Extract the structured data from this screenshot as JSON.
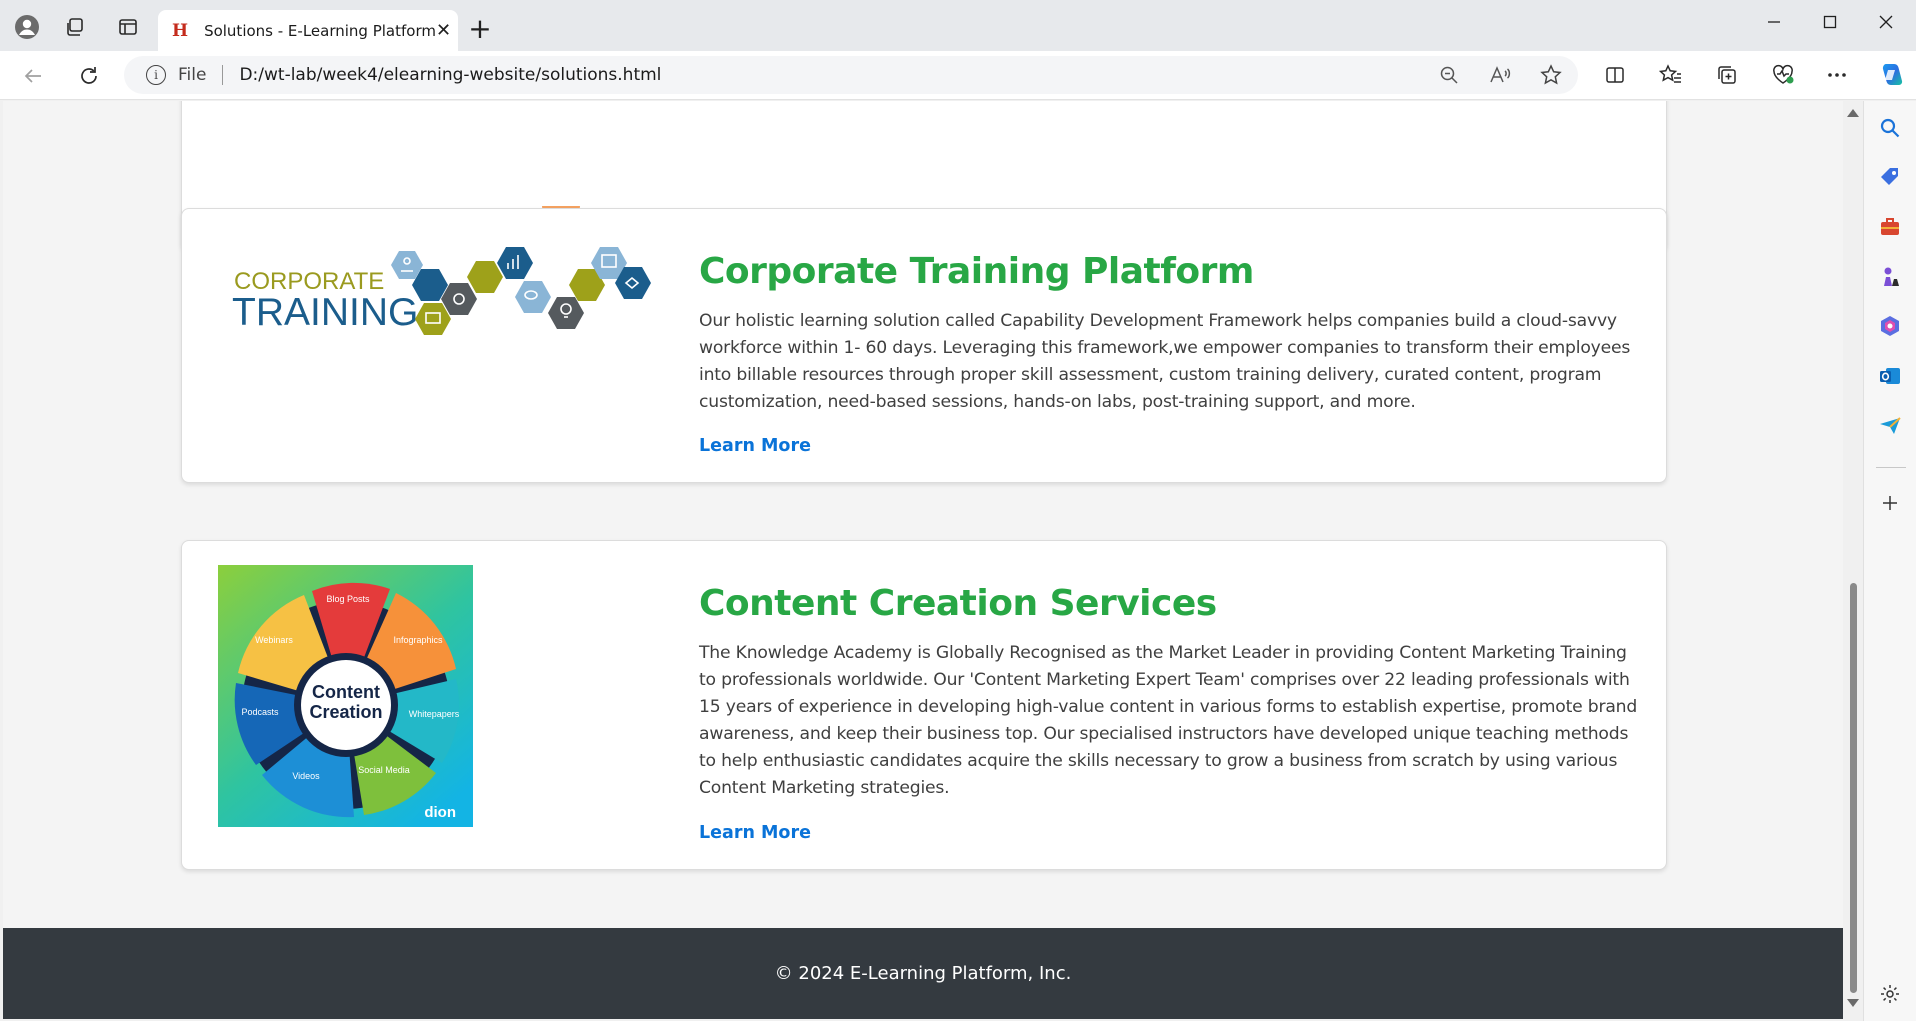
{
  "browser": {
    "tab_title": "Solutions - E-Learning Platform",
    "tab_favicon_letter": "H",
    "tab_close": "✕",
    "new_tab": "+",
    "url_scheme": "File",
    "url": "D:/wt-lab/week4/elearning-website/solutions.html"
  },
  "cards": [
    {
      "image_caption_line1": "CORPORATE",
      "image_caption_line2": "TRAINING",
      "title": "Corporate Training Platform",
      "description": "Our holistic learning solution called Capability Development Framework helps companies build a cloud-savvy workforce within 1- 60 days. Leveraging this framework,we empower companies to transform their employees into billable resources through proper skill assessment, custom training delivery, curated content, program customization, need-based sessions, hands-on labs, post-training support, and more.",
      "link": "Learn More"
    },
    {
      "image_center_line1": "Content",
      "image_center_line2": "Creation",
      "image_segments": [
        "Blog Posts",
        "Infographics",
        "Whitepapers",
        "Social Media",
        "Videos",
        "Podcasts",
        "Webinars"
      ],
      "image_brand": "dion",
      "title": "Content Creation Services",
      "description": "The Knowledge Academy is Globally Recognised as the Market Leader in providing Content Marketing Training to professionals worldwide. Our 'Content Marketing Expert Team' comprises over 22 leading professionals with 15 years of experience in developing high-value content in various forms to establish expertise, promote brand awareness, and keep their business top. Our specialised instructors have developed unique teaching methods to help enthusiastic candidates acquire the skills necessary to grow a business from scratch by using various Content Marketing strategies.",
      "link": "Learn More"
    }
  ],
  "footer": {
    "text": "© 2024 E-Learning Platform, Inc."
  },
  "colors": {
    "title_green": "#28a745",
    "link_blue": "#0a73d8",
    "footer_bg": "#343a40"
  }
}
